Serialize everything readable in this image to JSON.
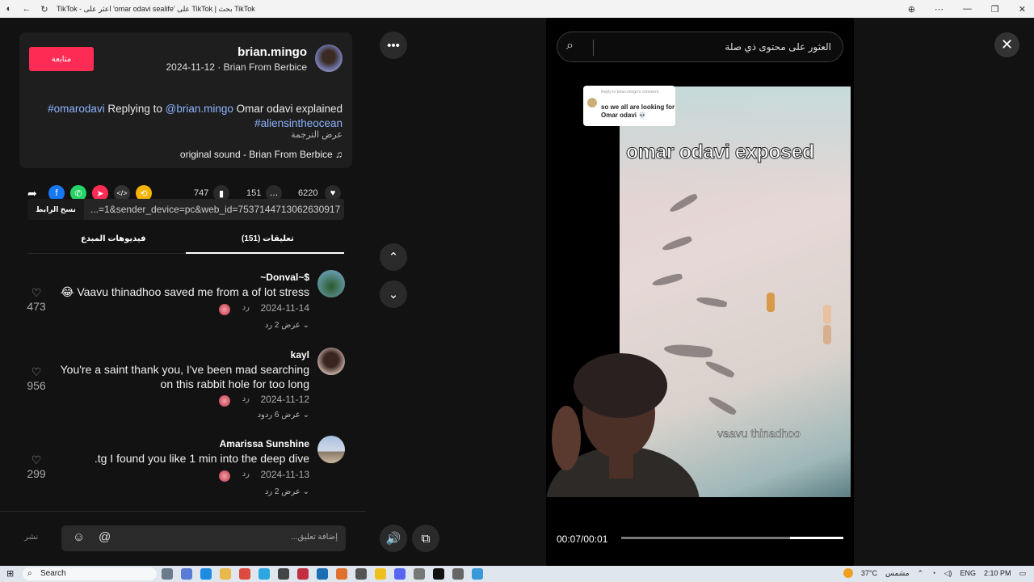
{
  "browser": {
    "title": "TikTok - اعثر على 'omar odavi sealife' على TikTok | بحث TikTok"
  },
  "post": {
    "follow_label": "متابعة",
    "username": "brian.mingo",
    "meta": "2024-11-12 · Brian From Berbice",
    "desc_tag1": "#omarodavi",
    "desc_reply": " Replying to ",
    "desc_mention": "@brian.mingo",
    "desc_rest": " Omar odavi explained",
    "desc_tag2": "#aliensintheocean",
    "translate": "عرض الترجمة",
    "sound": "original sound - Brian From Berbice"
  },
  "actions": {
    "likes": "6220",
    "comments": "151",
    "saves": "747"
  },
  "link": {
    "copy_label": "نسخ الرابط",
    "url_text": "...=1&sender_device=pc&web_id=7537144713062630917"
  },
  "tabs": {
    "comments": "تعليقات (151)",
    "creator_videos": "فيديوهات المبدع"
  },
  "comments": [
    {
      "name": "~Donval~$",
      "text": "😂 Vaavu thinadhoo saved me from a of lot stress",
      "date": "2024-11-14",
      "reply": "رد",
      "more": "عرض 2 رد",
      "likes": "473"
    },
    {
      "name": "kayl",
      "text": "You're a saint thank you, I've been mad searching on this rabbit hole for too long",
      "date": "2024-11-12",
      "reply": "رد",
      "more": "عرض 6 ردود",
      "likes": "956"
    },
    {
      "name": "Amarissa Sunshine",
      "text": ".tg I found you like 1 min into the deep dive",
      "date": "2024-11-13",
      "reply": "رد",
      "more": "عرض 2 رد",
      "likes": "299"
    }
  ],
  "comment_input": {
    "placeholder": "...إضافة تعليق",
    "post_label": "نشر"
  },
  "video": {
    "search_placeholder": "العثور على محتوى ذي صلة",
    "bubble_small": "Reply to brian.mingo's comment",
    "bubble_text": "so we all are looking for Omar odavi 💀",
    "overlay_title": "omar odavi exposed",
    "overlay_sub": "vaavu thinadhoo",
    "time": "00:07/00:01",
    "progress": 0.76
  },
  "taskbar": {
    "search_label": "Search",
    "weather": "37°C",
    "weather_text": "مشمس",
    "lang": "ENG",
    "clock": "2:10 PM"
  },
  "colors": {
    "accent": "#fe2c55",
    "link": "#8cb4ff",
    "background": "#121212"
  }
}
